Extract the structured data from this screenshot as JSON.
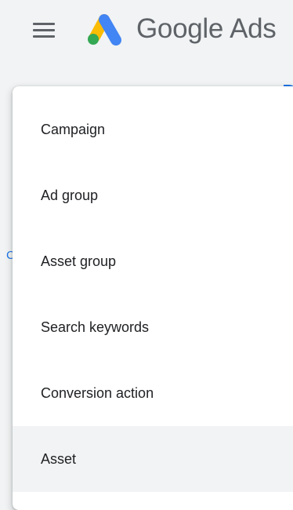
{
  "header": {
    "menu_icon": "hamburger-menu-icon",
    "logo_icon": "google-ads-logo",
    "brand_google": "Google",
    "brand_ads": "Ads"
  },
  "background": {
    "partial_text": "C"
  },
  "dropdown": {
    "items": [
      {
        "label": "Campaign"
      },
      {
        "label": "Ad group"
      },
      {
        "label": "Asset group"
      },
      {
        "label": "Search keywords"
      },
      {
        "label": "Conversion action"
      },
      {
        "label": "Asset"
      }
    ],
    "selected_index": 5
  },
  "colors": {
    "header_bg": "#f1f3f4",
    "text_primary": "#202124",
    "text_secondary": "#5f6368",
    "accent": "#1a73e8",
    "logo_yellow": "#fbbc04",
    "logo_blue": "#4285f4",
    "logo_green": "#34a853",
    "selected_bg": "#f1f3f4"
  }
}
